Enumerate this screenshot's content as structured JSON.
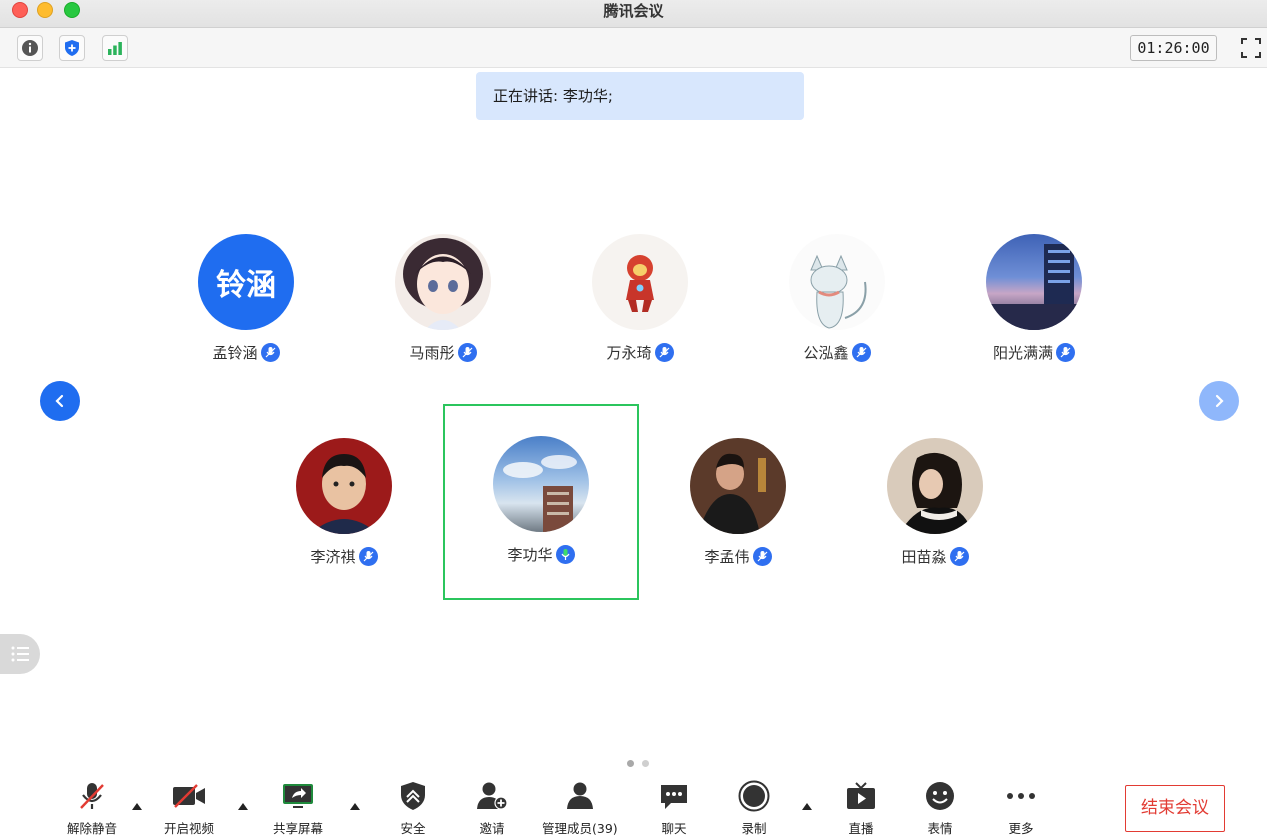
{
  "window": {
    "title": "腾讯会议"
  },
  "topbar": {
    "timer": "01:26:00"
  },
  "speaking": {
    "label": "正在讲话: 李功华;"
  },
  "participants_row1": [
    {
      "name": "孟铃涵",
      "avatar_text": "铃涵",
      "avatar": "text-avatar"
    },
    {
      "name": "马雨彤",
      "avatar": "anime-girl"
    },
    {
      "name": "万永琦",
      "avatar": "cartoon-hero"
    },
    {
      "name": "公泓鑫",
      "avatar": "sketch-cat"
    },
    {
      "name": "阳光满满",
      "avatar": "city-night"
    }
  ],
  "participants_row2": [
    {
      "name": "李济祺",
      "avatar": "child-photo"
    },
    {
      "name": "李功华",
      "avatar": "sky-building",
      "speaking": true
    },
    {
      "name": "李孟伟",
      "avatar": "man-photo"
    },
    {
      "name": "田苗淼",
      "avatar": "woman-photo"
    }
  ],
  "toolbar": {
    "mute": "解除静音",
    "video": "开启视频",
    "share": "共享屏幕",
    "security": "安全",
    "invite": "邀请",
    "members": "管理成员(39)",
    "chat": "聊天",
    "record": "录制",
    "live": "直播",
    "emoji": "表情",
    "more": "更多",
    "end": "结束会议"
  },
  "colors": {
    "accent": "#1f6df0",
    "speaking_frame": "#2bc55d",
    "end": "#e23b33"
  }
}
